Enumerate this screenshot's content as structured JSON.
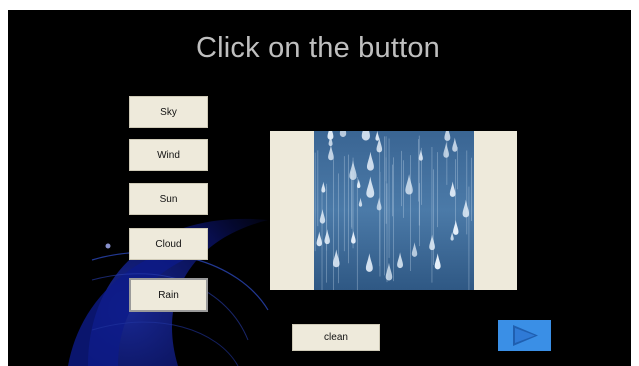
{
  "slide": {
    "title": "Click on the button"
  },
  "word_buttons": [
    {
      "label": "Sky"
    },
    {
      "label": "Wind"
    },
    {
      "label": "Sun"
    },
    {
      "label": "Cloud"
    },
    {
      "label": "Rain",
      "selected": true
    }
  ],
  "picture": {
    "subject": "rain",
    "icon": "rain-drops-image"
  },
  "clean_button": {
    "label": "clean"
  },
  "next_button": {
    "icon": "play-arrow-icon"
  },
  "colors": {
    "background": "#000000",
    "title": "#bfbfbf",
    "button_face": "#eeeadb",
    "next_button": "#3a8fe6",
    "rain_blue": "#3f6d9a"
  }
}
